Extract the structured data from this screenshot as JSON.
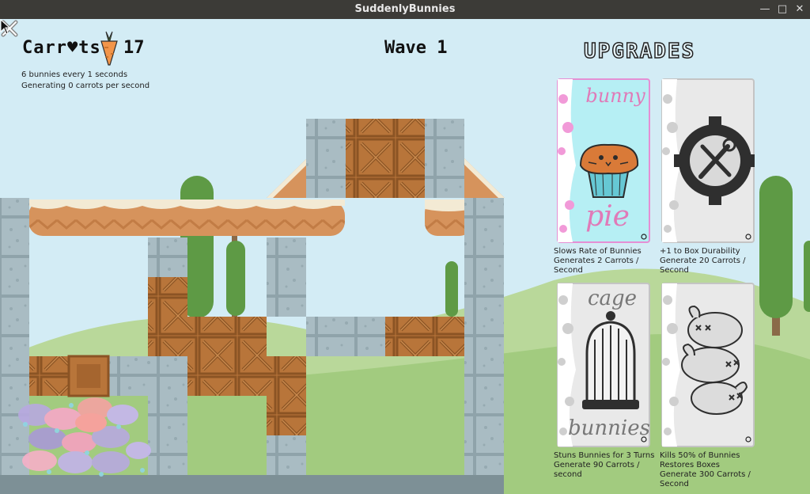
{
  "window": {
    "title": "SuddenlyBunnies"
  },
  "hud": {
    "carrots_label": "Carr♥ts",
    "carrots_count": "17",
    "rate_line": "6 bunnies every 1 seconds",
    "generating_line": "Generating 0 carrots per second",
    "wave_label": "Wave 1"
  },
  "upgrades": {
    "title": "UPGRADES",
    "cards": [
      {
        "top_word": "bunny",
        "bottom_word": "pie",
        "line1": "Slows Rate of Bunnies",
        "line2": "Generates 2 Carrots /",
        "line3": "Second",
        "icon": "pie-icon"
      },
      {
        "top_word": "",
        "bottom_word": "",
        "line1": "+1 to Box Durability",
        "line2": "Generate 20 Carrots /",
        "line3": "Second",
        "icon": "gear-tools-icon"
      },
      {
        "top_word": "cage",
        "bottom_word": "bunnies",
        "line1": "Stuns Bunnies for 3 Turns",
        "line2": "Generate 90 Carrots /",
        "line3": "second",
        "icon": "cage-icon"
      },
      {
        "top_word": "",
        "bottom_word": "",
        "line1": "Kills 50% of Bunnies",
        "line2": "Restores Boxes",
        "line3": "Generate 300 Carrots /",
        "line4": "Second",
        "icon": "dead-bunnies-icon"
      }
    ]
  },
  "colors": {
    "sky": "#d3ecf5",
    "stone": "#a9bcc3",
    "crate": "#b8753a",
    "pie_card": "#b6eff4",
    "grass": "#9cc77a"
  }
}
